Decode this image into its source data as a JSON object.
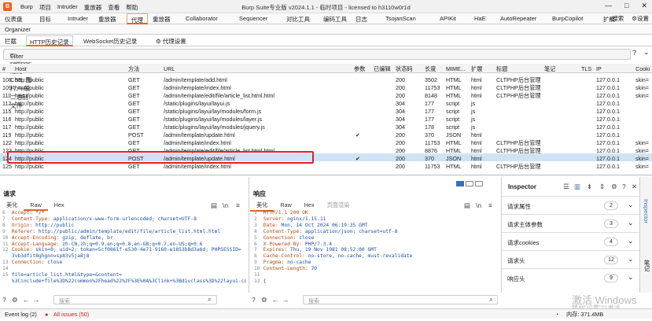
{
  "window": {
    "title": "Burp Suite专业版  v2024.1.1 - 临时项目 - licensed to h3110w0r1d",
    "logo": "B",
    "menu": [
      "Burp",
      "项目",
      "Intruder",
      "重放器",
      "查看",
      "帮助"
    ],
    "controls": [
      "—",
      "□",
      "✕"
    ]
  },
  "tabs_main": [
    "仪表盘",
    "目标",
    "Intruder",
    "重放器",
    "代理",
    "重放器",
    "Collaborator",
    "Sequencer",
    "对比工具",
    "编码工具",
    "日志",
    "TsojanScan",
    "APIKit",
    "HaE",
    "AutoRepeater",
    "BurpCopilot",
    "扩展"
  ],
  "tabs_main_active": 4,
  "tabs_main_right": {
    "search": "搜索",
    "settings": "设置"
  },
  "organizer": "Organizer",
  "proxy_tabs": {
    "intercept": "拦截",
    "http_history": "HTTP历史记录",
    "ws_history": "WebSocket历史记录",
    "proxy_settings": "代理设置"
  },
  "filter": {
    "text": "Filter settings: 隐藏CSS, 图片,一般二进制文件",
    "help": "?",
    "expand": "⌄"
  },
  "table": {
    "columns": [
      "#",
      "Host",
      "方法",
      "URL",
      "参数",
      "已编辑",
      "状态码",
      "长度",
      "MIME...",
      "扩展",
      "标题",
      "笔记",
      "TLS",
      "IP",
      "Cooki"
    ],
    "rows": [
      {
        "id": "108",
        "host": "http://public",
        "method": "GET",
        "url": "/admin/template/add.html",
        "params": "",
        "status": "200",
        "length": "3502",
        "mime": "HTML",
        "ext": "html",
        "title": "CLTPHP后台管理",
        "ip": "127.0.0.1",
        "cookie": "skin="
      },
      {
        "id": "109",
        "host": "http://public",
        "method": "GET",
        "url": "/admin/template/index.html",
        "params": "",
        "status": "200",
        "length": "11753",
        "mime": "HTML",
        "ext": "html",
        "title": "CLTPHP后台管理",
        "ip": "127.0.0.1",
        "cookie": "skin="
      },
      {
        "id": "110",
        "host": "http://public",
        "method": "GET",
        "url": "/admin/template/edit/file/article_list.html.html",
        "params": "",
        "status": "200",
        "length": "8148",
        "mime": "HTML",
        "ext": "html",
        "title": "CLTPHP后台管理",
        "ip": "127.0.0.1",
        "cookie": "skin="
      },
      {
        "id": "112",
        "host": "http://public",
        "method": "GET",
        "url": "/static/plugins/layui/layui.js",
        "params": "",
        "status": "304",
        "length": "177",
        "mime": "script",
        "ext": "js",
        "title": "",
        "ip": "127.0.0.1",
        "cookie": ""
      },
      {
        "id": "115",
        "host": "http://public",
        "method": "GET",
        "url": "/static/plugins/layui/lay/modules/form.js",
        "params": "",
        "status": "304",
        "length": "177",
        "mime": "script",
        "ext": "js",
        "title": "",
        "ip": "127.0.0.1",
        "cookie": ""
      },
      {
        "id": "116",
        "host": "http://public",
        "method": "GET",
        "url": "/static/plugins/layui/lay/modules/layer.js",
        "params": "",
        "status": "304",
        "length": "177",
        "mime": "script",
        "ext": "js",
        "title": "",
        "ip": "127.0.0.1",
        "cookie": ""
      },
      {
        "id": "117",
        "host": "http://public",
        "method": "GET",
        "url": "/static/plugins/layui/lay/modules/jquery.js",
        "params": "",
        "status": "304",
        "length": "178",
        "mime": "script",
        "ext": "js",
        "title": "",
        "ip": "127.0.0.1",
        "cookie": ""
      },
      {
        "id": "119",
        "host": "http://public",
        "method": "POST",
        "url": "/admin/template/update.html",
        "params": "✔",
        "status": "200",
        "length": "370",
        "mime": "JSON",
        "ext": "html",
        "title": "",
        "ip": "127.0.0.1",
        "cookie": ""
      },
      {
        "id": "122",
        "host": "http://public",
        "method": "GET",
        "url": "/admin/template/index.html",
        "params": "",
        "status": "200",
        "length": "11753",
        "mime": "HTML",
        "ext": "html",
        "title": "CLTPHP后台管理",
        "ip": "127.0.0.1",
        "cookie": "skin="
      },
      {
        "id": "123",
        "host": "http://public",
        "method": "GET",
        "url": "/admin/template/edit/file/article_list.html.html",
        "params": "",
        "status": "200",
        "length": "8876",
        "mime": "HTML",
        "ext": "html",
        "title": "CLTPHP后台管理",
        "ip": "127.0.0.1",
        "cookie": "skin="
      },
      {
        "id": "124",
        "host": "http://public",
        "method": "POST",
        "url": "/admin/template/update.html",
        "params": "✔",
        "status": "200",
        "length": "370",
        "mime": "JSON",
        "ext": "html",
        "title": "",
        "ip": "127.0.0.1",
        "cookie": "skin="
      },
      {
        "id": "125",
        "host": "http://public",
        "method": "GET",
        "url": "/admin/template/index.html",
        "params": "",
        "status": "200",
        "length": "11753",
        "mime": "HTML",
        "ext": "html",
        "title": "CLTPHP后台管理",
        "ip": "127.0.0.1",
        "cookie": "skin="
      }
    ],
    "selected_row": 10
  },
  "request": {
    "title": "请求",
    "tabs": [
      "美化",
      "Raw",
      "Hex"
    ],
    "active_tab": 1,
    "lines": [
      {
        "n": "6",
        "k": "Accept:",
        "v": " */*"
      },
      {
        "n": "7",
        "k": "Content-Type:",
        "v": " application/x-www-form-urlencoded; charset=UTF-8"
      },
      {
        "n": "8",
        "k": "Origin:",
        "v": " http://public"
      },
      {
        "n": "9",
        "k": "Referer:",
        "v": " http://public/admin/template/edit/file/article_list.html.html"
      },
      {
        "n": "10",
        "k": "Accept-Encoding:",
        "v": " gzip, deflate, br"
      },
      {
        "n": "11",
        "k": "Accept-Language:",
        "v": " zh-CN,zh;q=0.9,en;q=0.8,en-GB;q=0.7,en-US;q=0.6"
      },
      {
        "n": "12",
        "k": "Cookie:",
        "v": " skin=0; uid=2; token=5cf0861f-e530-4e71-9160-e1853b8d3a6d; PHPSESSID="
      },
      {
        "n": "",
        "k": "",
        "v": "3vb3dfit8ghgnnvsp83v5ja8j8"
      },
      {
        "n": "13",
        "k": "Connection:",
        "v": " close"
      },
      {
        "n": "14",
        "k": "",
        "v": ""
      },
      {
        "n": "15",
        "k": "",
        "v": "file=article_list.html&type=&content="
      },
      {
        "n": "",
        "k": "",
        "v": "%3Cinclude+file%3D%22common%2Fhead%22%2F%3E%0A%3Clink+%3Bdivclass%3D%22layui-cont"
      }
    ],
    "search_placeholder": "搜索",
    "highlights": "0 高亮"
  },
  "response": {
    "title": "响应",
    "tabs": [
      "美化",
      "Raw",
      "Hex",
      "页面渲染"
    ],
    "active_tab": 0,
    "lines": [
      {
        "n": "1",
        "k": "HTTP/1.1 200 OK",
        "v": ""
      },
      {
        "n": "2",
        "k": "Server:",
        "v": " nginx/1.15.11"
      },
      {
        "n": "3",
        "k": "Date:",
        "v": " Mon, 14 Oct 2024 06:19:35 GMT"
      },
      {
        "n": "4",
        "k": "Content-Type:",
        "v": " application/json; charset=utf-8"
      },
      {
        "n": "5",
        "k": "Connection:",
        "v": " close"
      },
      {
        "n": "6",
        "k": "X-Powered-By:",
        "v": " PHP/7.3.4"
      },
      {
        "n": "7",
        "k": "Expires:",
        "v": " Thu, 19 Nov 1981 08:52:00 GMT"
      },
      {
        "n": "8",
        "k": "Cache-Control:",
        "v": " no-store, no-cache, must-revalidate"
      },
      {
        "n": "9",
        "k": "Pragma:",
        "v": " no-cache"
      },
      {
        "n": "10",
        "k": "Content-Length:",
        "v": " 70"
      },
      {
        "n": "11",
        "k": "",
        "v": ""
      },
      {
        "n": "12",
        "k": "",
        "v": "{"
      }
    ],
    "search_placeholder": "搜索"
  },
  "inspector": {
    "title": "Inspector",
    "items": [
      {
        "label": "请求属性",
        "count": "2"
      },
      {
        "label": "请求主体参数",
        "count": "3"
      },
      {
        "label": "请求cookies",
        "count": "4"
      },
      {
        "label": "请求头",
        "count": "12"
      },
      {
        "label": "响应头",
        "count": "9"
      }
    ],
    "side_tabs": [
      "Inspector",
      "笔记"
    ]
  },
  "statusbar": {
    "event_log": "Event log (2)",
    "all_issues": "All issues (50)",
    "memory": "内存: 371.4MB"
  },
  "watermark": {
    "line1": "激活 Windows",
    "line2": "转到\"设置\"以激活 Windows。"
  },
  "colors": {
    "accent": "#e8641b",
    "selected_row": "#cfe3f6",
    "red_box": "#e02020",
    "issues": "#d02020"
  }
}
